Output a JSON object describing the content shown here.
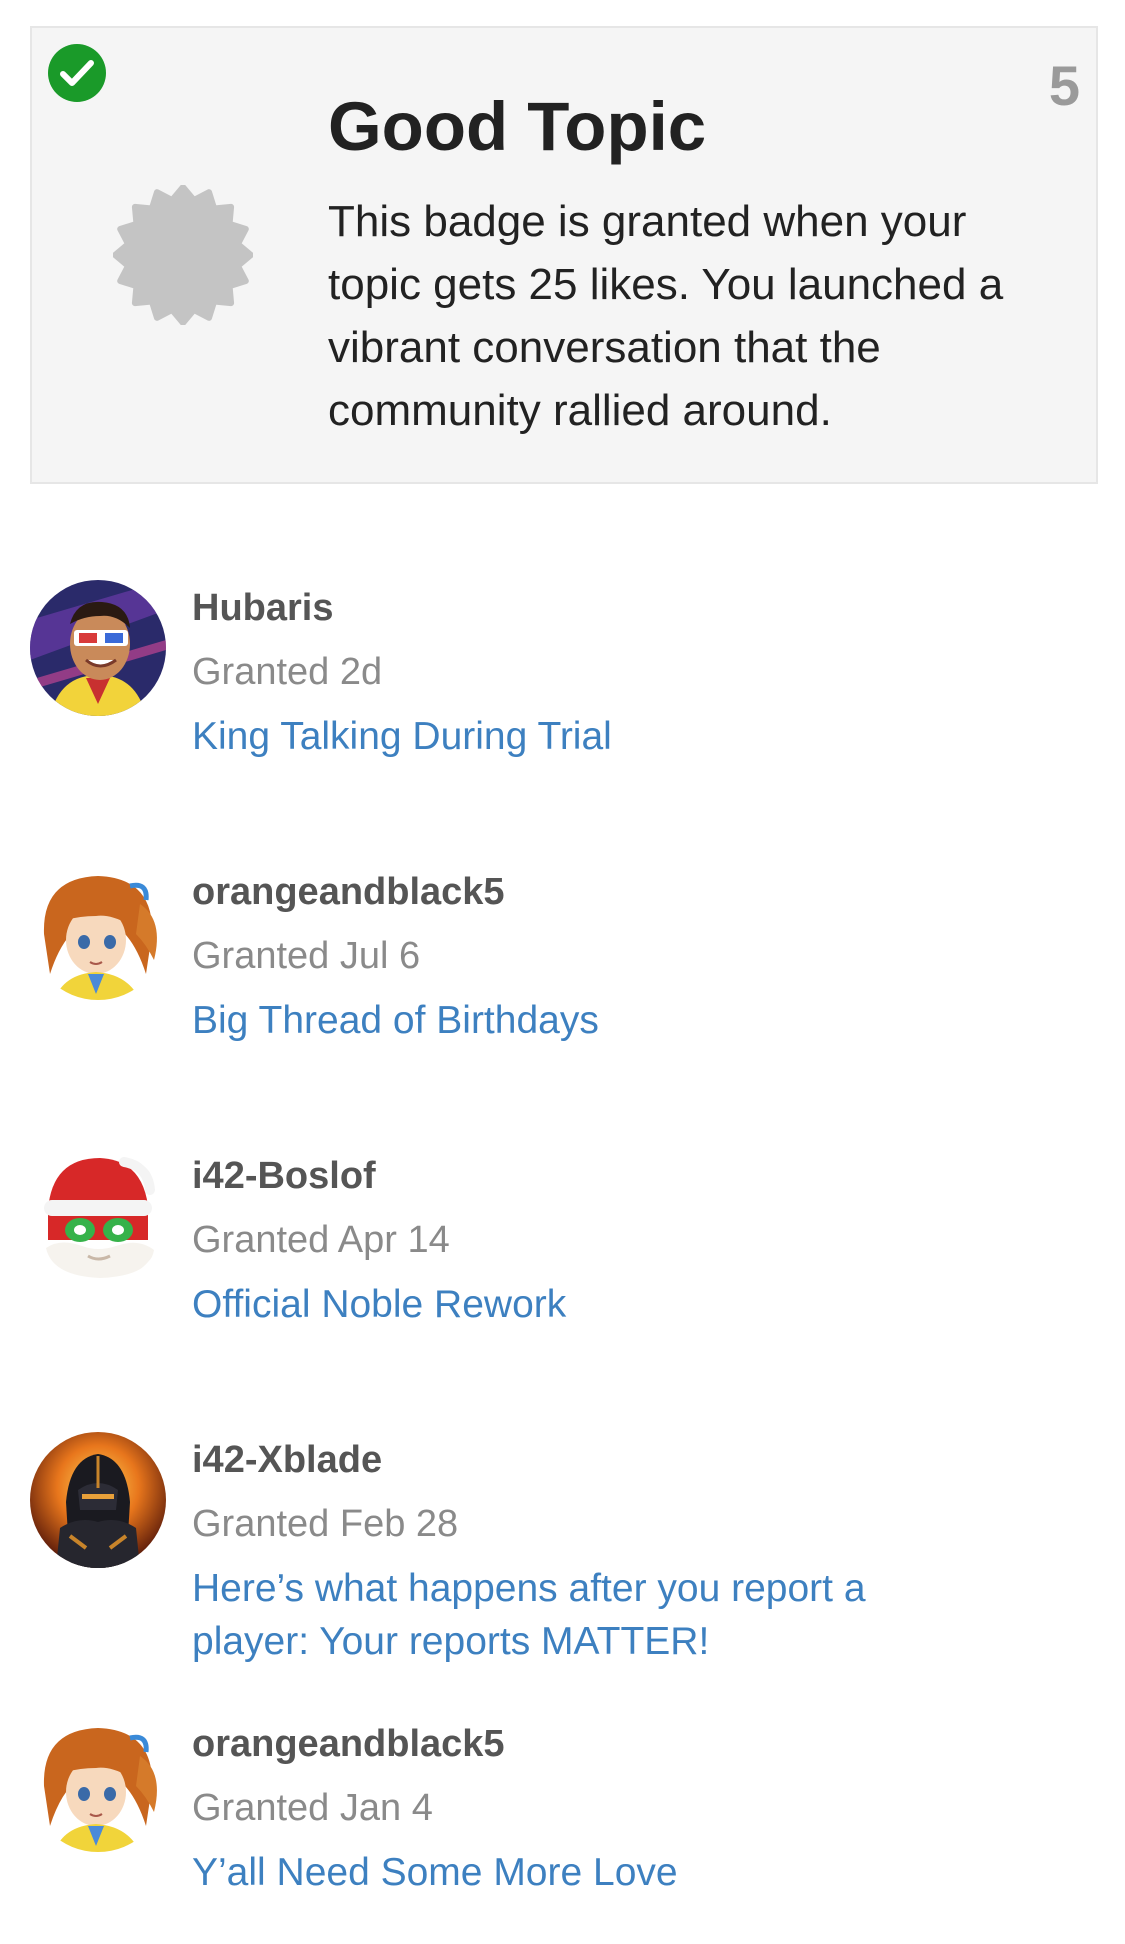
{
  "badge": {
    "title": "Good Topic",
    "description": "This badge is granted when your topic gets 25 likes. You launched a vibrant conversation that the community rallied around.",
    "count": "5",
    "granted_icon": "check-circle-icon",
    "badge_icon": "certificate-icon",
    "colors": {
      "check": "#1a9a29",
      "badge_icon": "#c4c4c4",
      "card_background": "#f5f5f5",
      "link": "#3d80c0",
      "username": "#555555",
      "date": "#8a8a8a"
    }
  },
  "grants": [
    {
      "username": "Hubaris",
      "date": "Granted 2d",
      "topic": "King Talking During Trial"
    },
    {
      "username": "orangeandblack5",
      "date": "Granted Jul 6",
      "topic": "Big Thread of Birthdays"
    },
    {
      "username": "i42-Boslof",
      "date": "Granted Apr 14",
      "topic": "Official Noble Rework"
    },
    {
      "username": "i42-Xblade",
      "date": "Granted Feb 28",
      "topic": "Here’s what happens after you report a player: Your reports MATTER!"
    },
    {
      "username": "orangeandblack5",
      "date": "Granted Jan 4",
      "topic": "Y’all Need Some More Love"
    }
  ]
}
